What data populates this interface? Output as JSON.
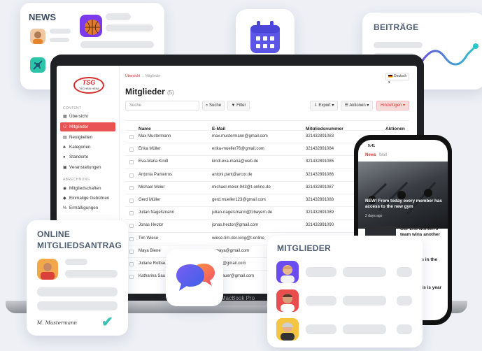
{
  "news_card": {
    "title": "NEWS"
  },
  "beitraege_card": {
    "title": "BEITRÄGE"
  },
  "online_card": {
    "title_line1": "ONLINE",
    "title_line2": "MITGLIEDSANTRAG",
    "signature": "M. Mustermann"
  },
  "mitglieder_card": {
    "title": "MITGLIEDER"
  },
  "laptop": {
    "model_label": "MacBook Pro"
  },
  "app": {
    "logo_text": "TSG",
    "logo_sub": "TECHEM HEIM",
    "breadcrumb": {
      "home": "Übersicht",
      "sep": "→",
      "current": "Mitglieder"
    },
    "language": "Deutsch",
    "sections": {
      "content": "CONTENT",
      "admin": "ABRECHNUNG"
    },
    "nav": [
      {
        "label": "Übersicht",
        "icon": "grid-icon"
      },
      {
        "label": "Mitglieder",
        "icon": "users-icon"
      },
      {
        "label": "Neuigkeiten",
        "icon": "news-icon"
      },
      {
        "label": "Kategorien",
        "icon": "tags-icon"
      },
      {
        "label": "Standorte",
        "icon": "pin-icon"
      },
      {
        "label": "Veranstaltungen",
        "icon": "calendar-icon"
      },
      {
        "label": "Mitgliedschaften",
        "icon": "membership-icon"
      },
      {
        "label": "Einmalige Gebühren",
        "icon": "fee-icon"
      },
      {
        "label": "Ermäßigungen",
        "icon": "discount-icon"
      }
    ],
    "page_title": "Mitglieder",
    "count": "(5)",
    "search_placeholder": "Suche",
    "buttons": {
      "search": "Suche",
      "filter": "Filter",
      "export": "Export",
      "actions": "Aktionen",
      "add": "Hinzufügen"
    },
    "columns": [
      "Name",
      "E-Mail",
      "Mitgliedsnummer",
      "Aktionen"
    ],
    "rows": [
      {
        "name": "Max Mustermann",
        "email": "max.mustermann@gmail.com",
        "number": "321432891083"
      },
      {
        "name": "Erika Müller",
        "email": "erika-mueller76@gmail.com",
        "number": "321432891084"
      },
      {
        "name": "Eva-Maria Kindl",
        "email": "kindl.eva-maria@web.de",
        "number": "321432891085"
      },
      {
        "name": "Antonia Panterros",
        "email": "antoni.pant@arcor.de",
        "number": "321432891086"
      },
      {
        "name": "Michael Meier",
        "email": "michael-meier-943@t-online.de",
        "number": "321432891087"
      },
      {
        "name": "Gerd Müller",
        "email": "gerd.mueller123@gmail.com",
        "number": "321432891088"
      },
      {
        "name": "Julian Nagelsmann",
        "email": "julian-nagelsmann@fcbayern.de",
        "number": "321432891089"
      },
      {
        "name": "Jonas Hector",
        "email": "jonas.hector@gmail.com",
        "number": "321432891090"
      },
      {
        "name": "Tim Wiese",
        "email": "wiese-tim-der-king@t-online",
        "number": ""
      },
      {
        "name": "Maya Biene",
        "email": "n.maya@gmail.com",
        "number": ""
      },
      {
        "name": "Juliane Rotbau",
        "email": "baum@gmail.com",
        "number": ""
      },
      {
        "name": "Katharina Sau",
        "email": "rina.sauer@gmail.com",
        "number": ""
      }
    ]
  },
  "phone": {
    "time": "9:41",
    "tab_active": "News",
    "tab_other": "Wall",
    "headline": "NEW! From today every member has access to the new gym",
    "date": "2 days ago",
    "item1": "Our 2nd women's team wins another",
    "item2": "end, the as in the",
    "item3": "ely, the ty is is year"
  },
  "colors": {
    "accent": "#e95353",
    "heading": "#4f5d72",
    "teal": "#3bc2b5",
    "purple": "#5b56e8"
  }
}
